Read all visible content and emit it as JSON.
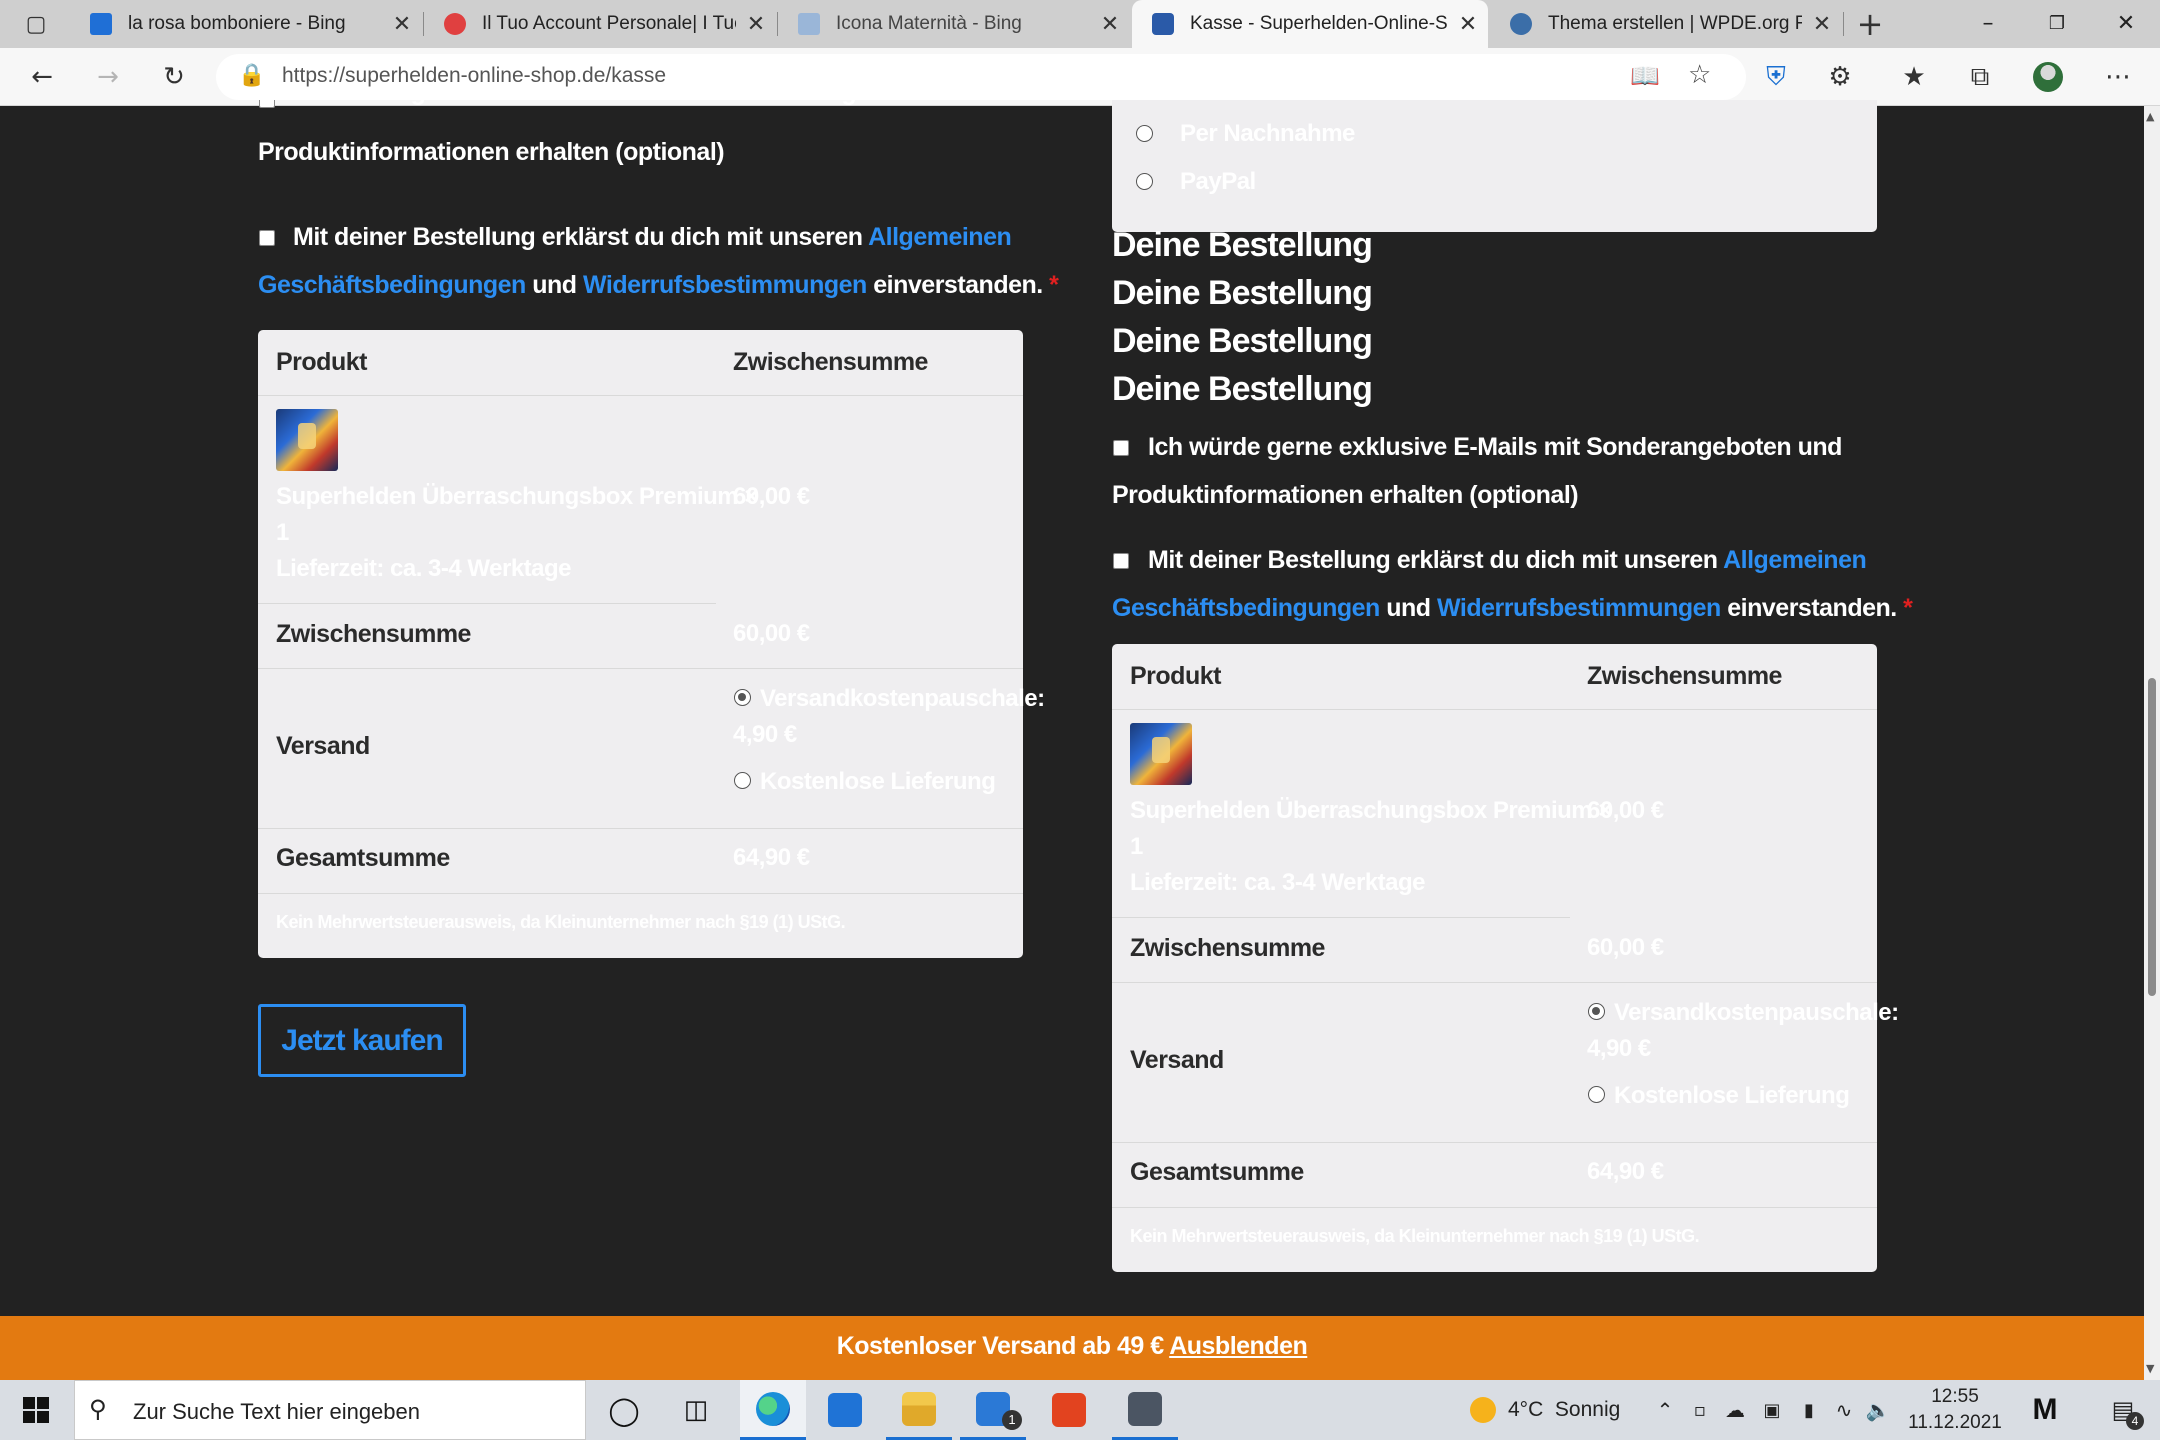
{
  "browser": {
    "tabs": [
      {
        "title": "la rosa bomboniere - Bing",
        "icon": "bing-icon",
        "color": "#1f6fd6",
        "active": false
      },
      {
        "title": "Il Tuo Account Personale| I Tuoi",
        "icon": "account-icon",
        "color": "#e04040",
        "active": false
      },
      {
        "title": "Icona Maternità - Bing",
        "icon": "bing-icon",
        "color": "#9ab6d8",
        "active": false
      },
      {
        "title": "Kasse - Superhelden-Online-Shop",
        "icon": "shop-icon",
        "color": "#2a5aa8",
        "active": true
      },
      {
        "title": "Thema erstellen | WPDE.org Forum",
        "icon": "wordpress-icon",
        "color": "#3b6ea8",
        "active": false
      }
    ],
    "url": "https://superhelden-online-shop.de/kasse"
  },
  "page": {
    "left": {
      "newsletter_text_line1": "Ich würde gerne exklusive E-Mails mit Sonderangeboten und",
      "newsletter_text_line2": "Produktinformationen erhalten (optional)",
      "terms_prefix": "Mit deiner Bestellung erklärst du dich mit unseren",
      "terms_link1a": "Allgemeinen",
      "terms_link1b": "Geschäftsbedingungen",
      "terms_and": "und",
      "terms_link2": "Widerrufsbestimmungen",
      "terms_suffix": "einverstanden.",
      "required_mark": "*",
      "buy_button": "Jetzt kaufen"
    },
    "right": {
      "payment_options": [
        "Per Nachnahme",
        "PayPal"
      ],
      "heading_repeated": [
        "Deine Bestellung",
        "Deine Bestellung",
        "Deine Bestellung",
        "Deine Bestellung"
      ],
      "newsletter_text_line1": "Ich würde gerne exklusive E-Mails mit Sonderangeboten und",
      "newsletter_text_line2": "Produktinformationen erhalten (optional)",
      "terms_prefix": "Mit deiner Bestellung erklärst du dich mit unseren",
      "terms_link1a": "Allgemeinen",
      "terms_link1b": "Geschäftsbedingungen",
      "terms_and": "und",
      "terms_link2": "Widerrufsbestimmungen",
      "terms_suffix": "einverstanden.",
      "required_mark": "*"
    },
    "order_table": {
      "col_product": "Produkt",
      "col_subtotal": "Zwischensumme",
      "product_name": "Superhelden Überraschungsbox Premium",
      "product_qty": "× 1",
      "product_qty_sign": "×",
      "product_qty_num": "1",
      "delivery_time": "Lieferzeit: ca. 3-4 Werktage",
      "product_price": "60,00 €",
      "subtotal_label": "Zwischensumme",
      "subtotal_value": "60,00 €",
      "shipping_label": "Versand",
      "shipping_option1_line1": "Versandkostenpauschale:",
      "shipping_option1_line2": "4,90 €",
      "shipping_option2": "Kostenlose Lieferung",
      "total_label": "Gesamtsumme",
      "total_value": "64,90 €",
      "tax_note": "Kein Mehrwertsteuerausweis, da Kleinunternehmer nach §19 (1) UStG."
    },
    "banner": {
      "text": "Kostenloser Versand ab 49 €",
      "link": "Ausblenden",
      "color": "#e37a11"
    }
  },
  "taskbar": {
    "search_placeholder": "Zur Suche Text hier eingeben",
    "weather": "4°C  Sonnig",
    "time": "12:55",
    "date": "11.12.2021",
    "mail_badge": "1",
    "notification_badge": "4"
  }
}
